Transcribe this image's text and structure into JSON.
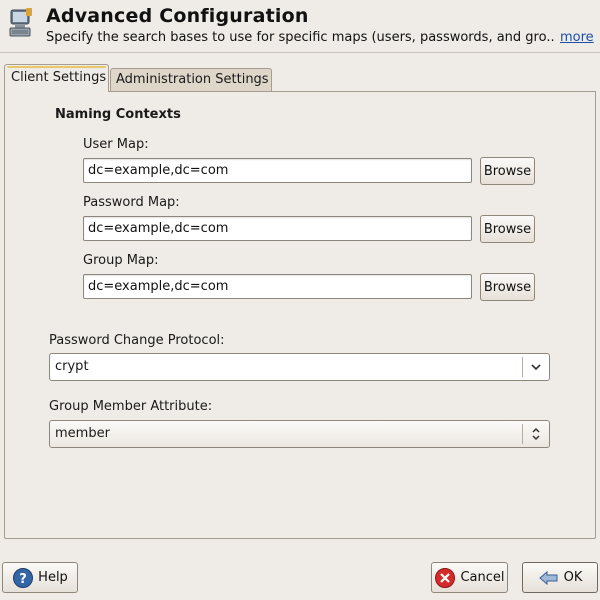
{
  "header": {
    "title": "Advanced Configuration",
    "subtitle": "Specify the search bases to use for specific maps (users, passwords, and gro...",
    "more_link": "more"
  },
  "tabs": [
    {
      "label": "Client Settings",
      "active": true
    },
    {
      "label": "Administration Settings",
      "active": false
    }
  ],
  "client_settings": {
    "group_title": "Naming Contexts",
    "user_map": {
      "label": "User Map:",
      "value": "dc=example,dc=com",
      "browse_label": "Browse"
    },
    "password_map": {
      "label": "Password Map:",
      "value": "dc=example,dc=com",
      "browse_label": "Browse"
    },
    "group_map": {
      "label": "Group Map:",
      "value": "dc=example,dc=com",
      "browse_label": "Browse"
    },
    "password_change_protocol": {
      "label": "Password Change Protocol:",
      "value": "crypt"
    },
    "group_member_attribute": {
      "label": "Group Member Attribute:",
      "value": "member"
    }
  },
  "footer": {
    "help_label": "Help",
    "cancel_label": "Cancel",
    "ok_label": "OK"
  },
  "icons": {
    "app": "network-computer-icon",
    "help": "help-icon",
    "cancel": "cancel-icon",
    "ok": "ok-arrow-icon"
  },
  "colors": {
    "background": "#efebe7",
    "link": "#1d4ea5",
    "tab_highlight": "#e8c86a",
    "cancel_red": "#d42a2a",
    "help_blue": "#3465a4"
  }
}
